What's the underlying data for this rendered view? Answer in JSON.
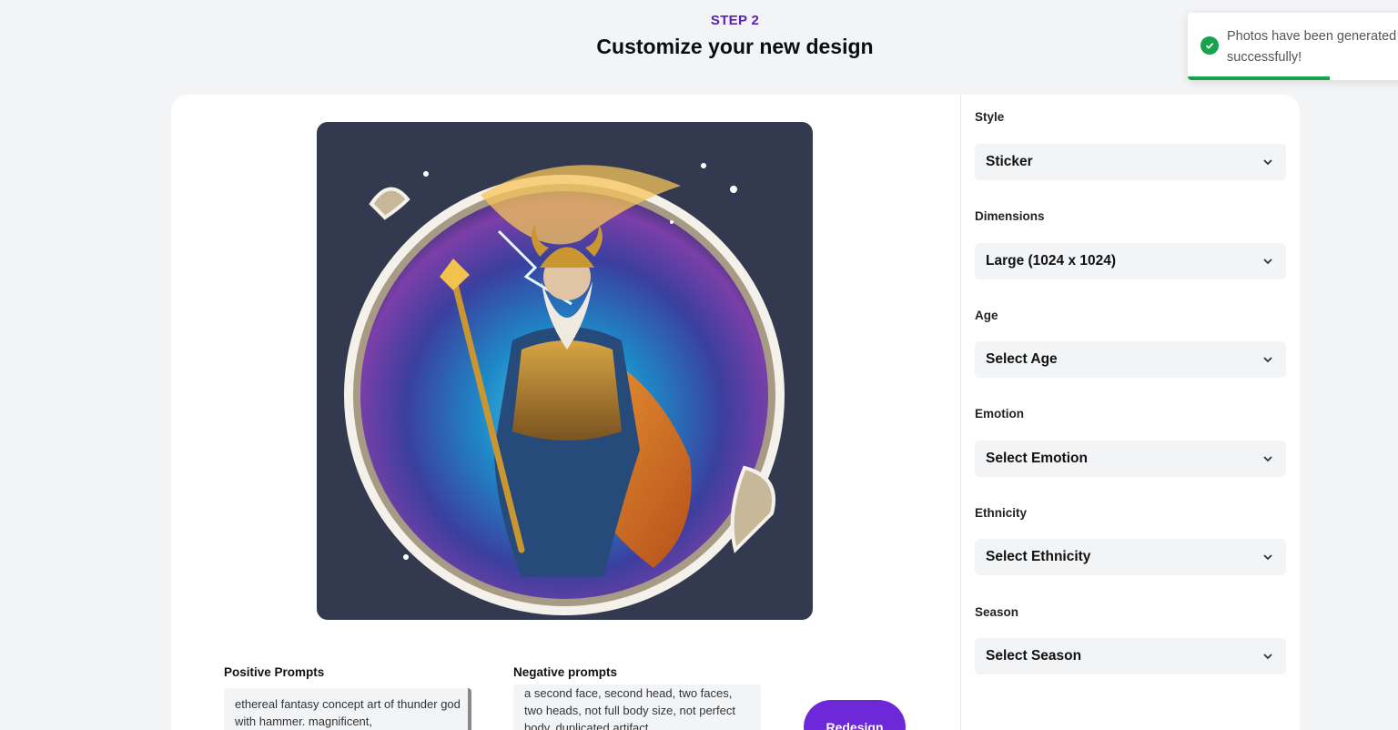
{
  "header": {
    "step": "STEP 2",
    "title": "Customize your new design"
  },
  "toast": {
    "message": "Photos have been generated successfully!",
    "status": "success",
    "progress": 0.6,
    "icon": "check-circle-icon",
    "color": "#16a34a"
  },
  "preview": {
    "image_subject": "fantasy sticker of a bearded thunder god in golden armor holding a hammer staff inside a circular cosmic frame"
  },
  "prompts": {
    "positive_label": "Positive Prompts",
    "positive_value": "ethereal fantasy concept art of thunder god with hammer. magnificent,",
    "negative_label": "Negative prompts",
    "negative_value": "a second face, second head, two faces, two heads, not full body size, not perfect body, duplicated artifact,"
  },
  "actions": {
    "redesign_label": "Redesign"
  },
  "options": {
    "style": {
      "label": "Style",
      "value": "Sticker"
    },
    "dimensions": {
      "label": "Dimensions",
      "value": "Large (1024 x 1024)"
    },
    "age": {
      "label": "Age",
      "value": "Select Age"
    },
    "emotion": {
      "label": "Emotion",
      "value": "Select Emotion"
    },
    "ethnicity": {
      "label": "Ethnicity",
      "value": "Select Ethnicity"
    },
    "season": {
      "label": "Season",
      "value": "Select Season"
    }
  },
  "colors": {
    "accent": "#6d28d9",
    "step_label": "#5b21b6",
    "image_background": "#333a4f"
  }
}
